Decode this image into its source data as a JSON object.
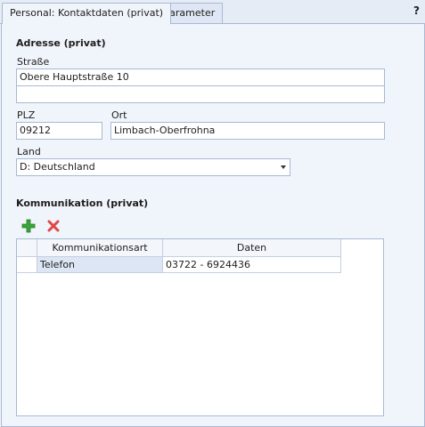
{
  "tabs": [
    {
      "label": "Personal: Kontaktdaten (privat)",
      "active": true
    },
    {
      "label": "Parameter",
      "active": false
    }
  ],
  "help_label": "?",
  "address": {
    "heading": "Adresse (privat)",
    "street_label": "Straße",
    "street_line1": "Obere Hauptstraße 10",
    "street_line2": "",
    "zip_label": "PLZ",
    "zip_value": "09212",
    "city_label": "Ort",
    "city_value": "Limbach-Oberfrohna",
    "country_label": "Land",
    "country_value": "D: Deutschland"
  },
  "communication": {
    "heading": "Kommunikation (privat)",
    "add_icon": "plus-icon",
    "delete_icon": "x-icon",
    "columns": [
      "Kommunikationsart",
      "Daten"
    ],
    "rows": [
      {
        "type": "Telefon",
        "data": "03722 - 6924436"
      }
    ]
  },
  "colors": {
    "background": "#f0f4fb",
    "border": "#a9b9d3",
    "add_green": "#3aa53a",
    "delete_red": "#e04848",
    "selected_cell": "#dce6f4"
  }
}
